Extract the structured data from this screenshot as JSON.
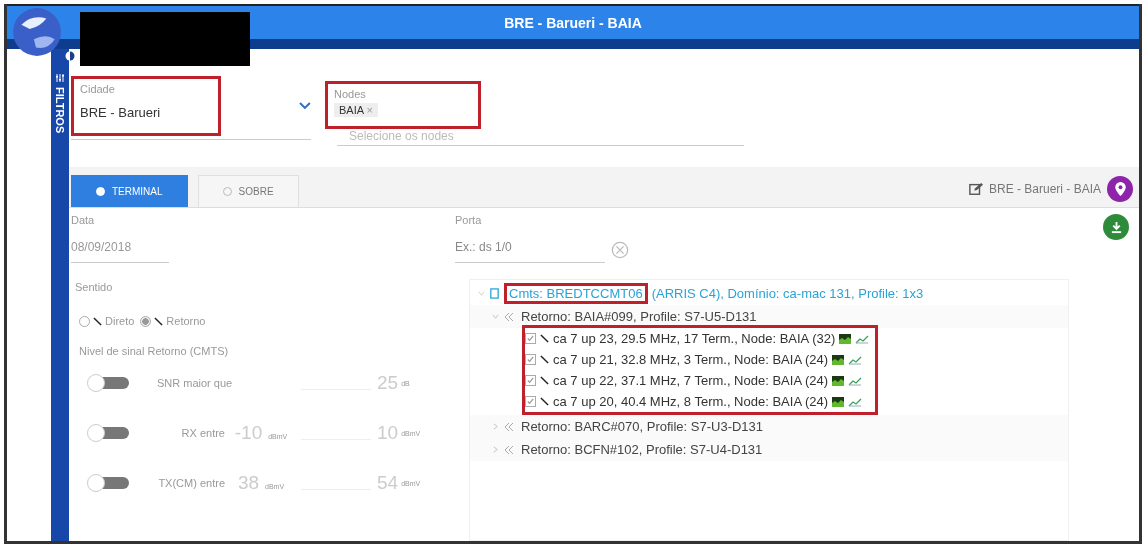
{
  "header": {
    "title": "BRE - Barueri - BAIA"
  },
  "sidebar": {
    "label": "FILTROS"
  },
  "filters": {
    "cidade": {
      "label": "Cidade",
      "value": "BRE - Barueri",
      "highlighted": true
    },
    "nodes": {
      "label": "Nodes",
      "chips": [
        {
          "label": "BAIA",
          "remove": "×"
        }
      ],
      "placeholder": "Selecione os nodes",
      "highlighted": true
    }
  },
  "tabs": [
    {
      "label": "TERMINAL",
      "selected": true
    },
    {
      "label": "SOBRE",
      "selected": false
    }
  ],
  "location": "BRE - Barueri - BAIA",
  "terminal": {
    "date_label": "Data",
    "date_value": "08/09/2018",
    "direction_label": "Sentido",
    "directions": [
      {
        "label": "Direto",
        "selected": false
      },
      {
        "label": "Retorno",
        "selected": true
      }
    ],
    "signal_label": "Nivel de sinal Retorno (CMTS)",
    "limits": [
      {
        "kind": "threshold",
        "on": false,
        "label": "SNR maior que",
        "max": "25",
        "max_unit": "dB"
      },
      {
        "kind": "range",
        "on": false,
        "label": "RX entre",
        "min": "-10",
        "min_unit": "dBmV",
        "max": "10",
        "max_unit": "dBmV"
      },
      {
        "kind": "range",
        "on": false,
        "label": "TX(CM) entre",
        "min": "38",
        "min_unit": "dBmV",
        "max": "54",
        "max_unit": "dBmV"
      }
    ]
  },
  "port": {
    "label": "Porta",
    "placeholder": "Ex.: ds 1/0"
  },
  "tree": [
    {
      "name": "Cmts: BREDTCCMT06",
      "label": "(ARRIS C4), Domínio: ca-mac 131, Profile: 1x3",
      "highlighted": true,
      "expanded": true,
      "children": [
        {
          "label": "Retorno: BAIA#099, Profile: S7-U5-D131",
          "expanded": true,
          "children_highlighted": true,
          "children": [
            {
              "label": "ca 7 up 23, 29.5 MHz, 17 Term., Node: BAIA (32)",
              "checked": true
            },
            {
              "label": "ca 7 up 21, 32.8 MHz, 3 Term., Node: BAIA (24)",
              "checked": true
            },
            {
              "label": "ca 7 up 22, 37.1 MHz, 7 Term., Node: BAIA (24)",
              "checked": true
            },
            {
              "label": "ca 7 up 20, 40.4 MHz, 8 Term., Node: BAIA (24)",
              "checked": true
            }
          ]
        },
        {
          "label": "Retorno: BARC#070, Profile: S7-U3-D131",
          "expanded": false
        },
        {
          "label": "Retorno: BCFN#102, Profile: S7-U4-D131",
          "expanded": false
        }
      ]
    }
  ]
}
